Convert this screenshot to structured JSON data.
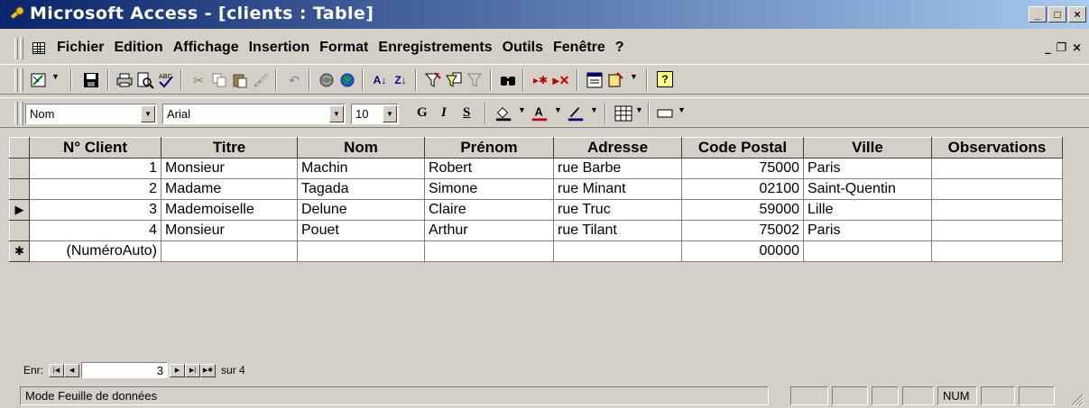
{
  "window": {
    "title": "Microsoft Access - [clients : Table]",
    "min": "_",
    "max": "□",
    "close": "×"
  },
  "menubar": {
    "items": [
      "Fichier",
      "Edition",
      "Affichage",
      "Insertion",
      "Format",
      "Enregistrements",
      "Outils",
      "Fenêtre",
      "?"
    ],
    "mdi_min": "_",
    "mdi_restore": "❐",
    "mdi_close": "×"
  },
  "toolbar": {
    "field_combo": "Nom",
    "font_combo": "Arial",
    "size_combo": "10",
    "bold": "G",
    "italic": "I",
    "underline": "S"
  },
  "table": {
    "columns": [
      "N° Client",
      "Titre",
      "Nom",
      "Prénom",
      "Adresse",
      "Code Postal",
      "Ville",
      "Observations"
    ],
    "rows": [
      {
        "selector": "",
        "n_client": "1",
        "titre": "Monsieur",
        "nom": "Machin",
        "prenom": "Robert",
        "adresse": "rue Barbe",
        "code_postal": "75000",
        "ville": "Paris",
        "observations": ""
      },
      {
        "selector": "",
        "n_client": "2",
        "titre": "Madame",
        "nom": "Tagada",
        "prenom": "Simone",
        "adresse": "rue Minant",
        "code_postal": "02100",
        "ville": "Saint-Quentin",
        "observations": ""
      },
      {
        "selector": "▶",
        "n_client": "3",
        "titre": "Mademoiselle",
        "nom": "Delune",
        "prenom": "Claire",
        "adresse": "rue Truc",
        "code_postal": "59000",
        "ville": "Lille",
        "observations": ""
      },
      {
        "selector": "",
        "n_client": "4",
        "titre": "Monsieur",
        "nom": "Pouet",
        "prenom": "Arthur",
        "adresse": "rue Tilant",
        "code_postal": "75002",
        "ville": "Paris",
        "observations": ""
      }
    ],
    "new_row": {
      "selector": "✱",
      "n_client": "(NuméroAuto)",
      "code_postal": "00000"
    }
  },
  "navigation": {
    "label": "Enr:",
    "current": "3",
    "total_label": "sur 4"
  },
  "statusbar": {
    "mode": "Mode Feuille de données",
    "num": "NUM"
  }
}
